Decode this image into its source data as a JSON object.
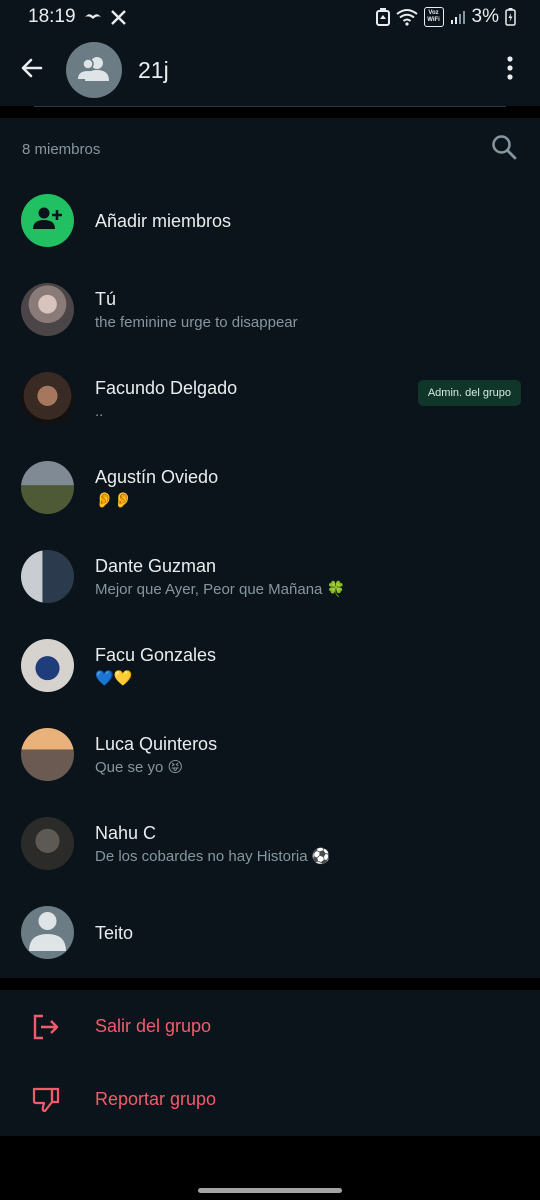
{
  "status_bar": {
    "time": "18:19",
    "battery_percent": "3%",
    "voz_label": "Voz",
    "wifi_label": "WiFi"
  },
  "app_bar": {
    "title": "21j"
  },
  "members_section": {
    "count_label": "8 miembros",
    "add_members_label": "Añadir miembros",
    "admin_badge": "Admin. del grupo",
    "members": [
      {
        "name": "Tú",
        "about": "the feminine urge to disappear"
      },
      {
        "name": "Facundo Delgado",
        "about": ".."
      },
      {
        "name": "Agustín Oviedo",
        "about": "👂👂"
      },
      {
        "name": "Dante Guzman",
        "about": "Mejor que Ayer,  Peor que Mañana 🍀"
      },
      {
        "name": "Facu Gonzales",
        "about": "💙💛"
      },
      {
        "name": "Luca Quinteros",
        "about": "Que se yo 😝"
      },
      {
        "name": "Nahu C",
        "about": "De los cobardes no hay Historia ⚽"
      },
      {
        "name": "Teito",
        "about": ""
      }
    ]
  },
  "actions": {
    "exit_label": "Salir del grupo",
    "report_label": "Reportar grupo"
  },
  "colors": {
    "background": "#0b141a",
    "accent_green": "#21c063",
    "danger": "#f15c6d",
    "secondary_text": "#8696a0"
  }
}
